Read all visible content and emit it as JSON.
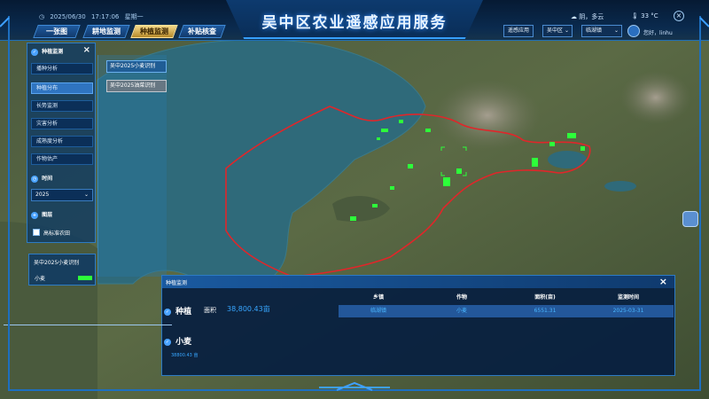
{
  "app": {
    "title": "吴中区农业遥感应用服务"
  },
  "datetime": {
    "date": "2025/06/30",
    "time": "17:17:06",
    "weekday": "星期一"
  },
  "weather": {
    "text": "阴，多云",
    "temp": "33 °C"
  },
  "nav": [
    {
      "label": "一张图"
    },
    {
      "label": "耕地监测"
    },
    {
      "label": "种植监测",
      "active": true
    },
    {
      "label": "补贴核查"
    }
  ],
  "controls": {
    "remote_app": "遥感应用",
    "district": "吴中区",
    "town": "临湖镇"
  },
  "user": {
    "greeting": "您好，linhu"
  },
  "left_panel": {
    "title": "种植监测",
    "items": [
      {
        "label": "播种分析"
      },
      {
        "label": "种植分布",
        "active": true
      },
      {
        "label": "长势监测"
      },
      {
        "label": "灾害分析"
      },
      {
        "label": "成熟度分析"
      },
      {
        "label": "作物估产"
      }
    ],
    "time_label": "时间",
    "year": "2025",
    "layers_label": "图层",
    "standard_farmland": "高标准农田"
  },
  "layer_chips": [
    {
      "label": "吴中2025小麦识别"
    },
    {
      "label": "吴中2025油菜识别"
    }
  ],
  "legend": {
    "title": "吴中2025小麦识别",
    "crop": "小麦",
    "color": "#2dff3a"
  },
  "bottom_panel": {
    "title": "种植监测",
    "planting_label": "种植",
    "area_label": "面积",
    "area_value": "38,800.43亩",
    "crop_label": "小麦",
    "crop_value": "38800.43 亩",
    "table": {
      "headers": [
        "乡镇",
        "作物",
        "面积(亩)",
        "监测时间"
      ],
      "rows": [
        [
          "临湖镇",
          "小麦",
          "6551.31",
          "2025-03-31"
        ]
      ]
    }
  },
  "icons": {
    "close": "close-icon",
    "time": "clock-icon",
    "layers": "layers-icon",
    "planting": "leaf-icon"
  },
  "colors": {
    "boundary": "#e0262a",
    "crop": "#2dff3a",
    "accent": "#37a6ff"
  }
}
